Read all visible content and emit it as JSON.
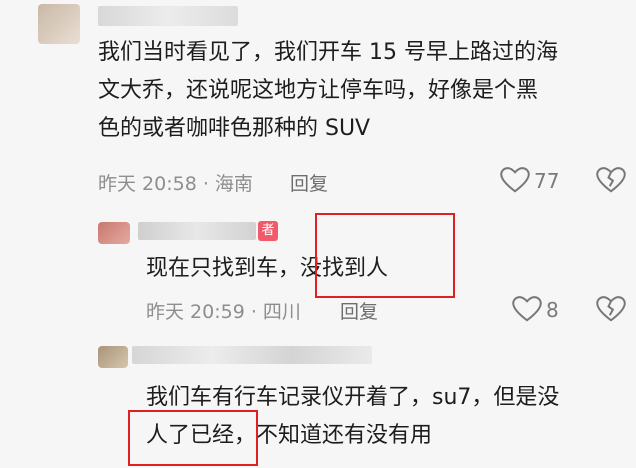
{
  "comments": [
    {
      "text_lines": [
        "我们当时看见了，我们开车 15 号早上路过的海",
        "文大乔，还说呢这地方让停车吗，好像是个黑",
        "色的或者咖啡色那种的 SUV"
      ],
      "time": "昨天 20:58",
      "location": "· 海南",
      "reply_label": "回复",
      "like_count": "77"
    },
    {
      "author_badge": "者",
      "text_before": "现在只找到车，",
      "text_highlight": "没找到人",
      "time": "昨天 20:59",
      "location": "· 四川",
      "reply_label": "回复",
      "like_count": "8"
    },
    {
      "text_line1": "我们车有行车记录仪开着了，su7，但是没",
      "text_highlight": "人了已经，",
      "text_after": "不知道还有没有用"
    }
  ],
  "colors": {
    "highlight_border": "#e02020",
    "badge": "#f05a6a"
  }
}
